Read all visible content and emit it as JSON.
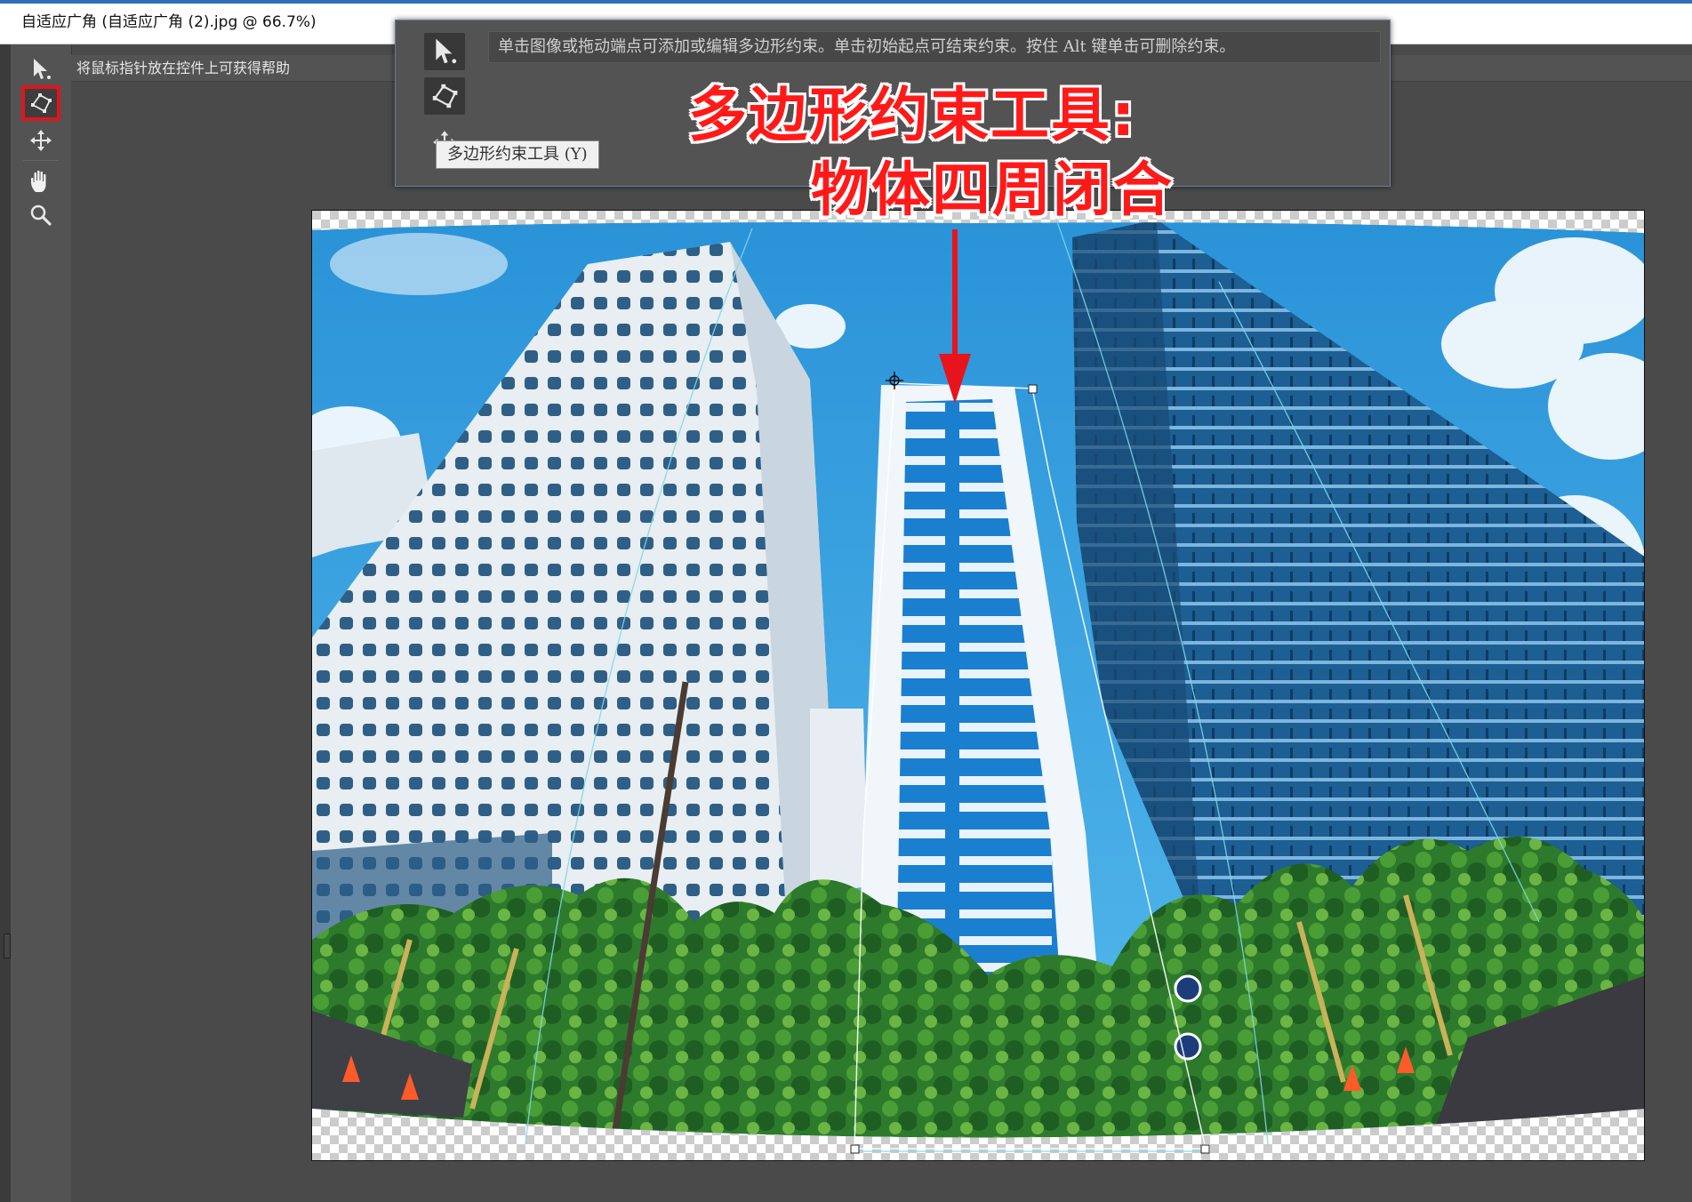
{
  "window": {
    "title": "自适应广角 (自适应广角 (2).jpg @ 66.7%)"
  },
  "hint_bar": {
    "text": "将鼠标指针放在控件上可获得帮助"
  },
  "toolbar": {
    "tools": [
      {
        "name": "constraint-tool",
        "icon": "arrow-constraint-icon",
        "active": false
      },
      {
        "name": "polygon-constraint-tool",
        "icon": "polygon-constraint-icon",
        "active": true
      },
      {
        "name": "move-tool",
        "icon": "move-icon",
        "active": false
      },
      {
        "name": "hand-tool",
        "icon": "hand-icon",
        "active": false
      },
      {
        "name": "zoom-tool",
        "icon": "zoom-icon",
        "active": false
      }
    ]
  },
  "popup": {
    "hint_text": "单击图像或拖动端点可添加或编辑多边形约束。单击初始起点可结束约束。按住 Alt 键单击可删除约束。",
    "tooltip": "多边形约束工具 (Y)"
  },
  "annotation": {
    "line1": "多边形约束工具:",
    "line2": "物体四周闭合",
    "color": "#ff1a1a"
  },
  "colors": {
    "sky": "#3aa6e4",
    "arrow": "#e8141c",
    "highlight_box": "#e0141e"
  }
}
